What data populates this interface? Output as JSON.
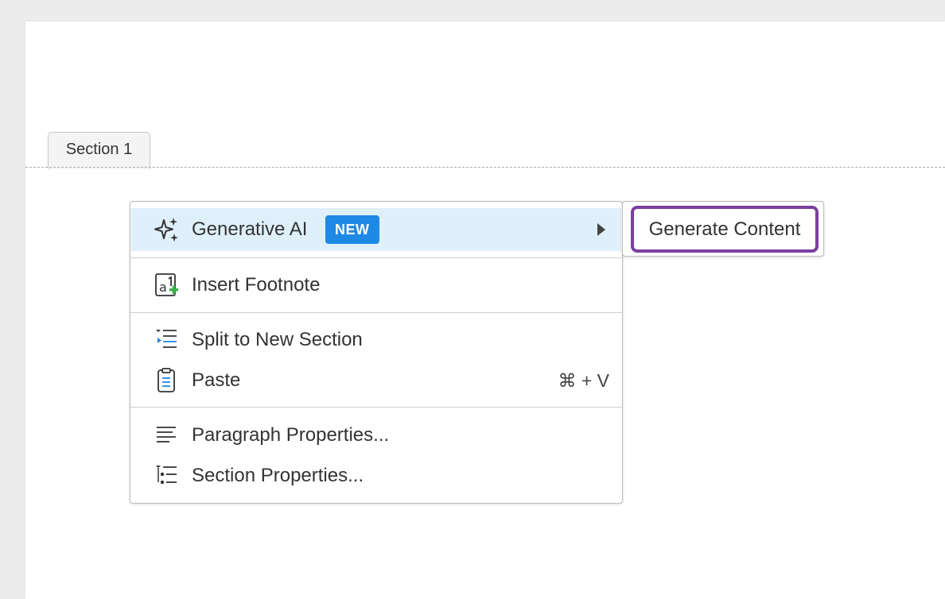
{
  "section": {
    "tab_label": "Section 1"
  },
  "context_menu": {
    "items": [
      {
        "label": "Generative AI",
        "badge": "NEW",
        "icon": "sparkles-icon"
      },
      {
        "label": "Insert Footnote",
        "icon": "footnote-icon"
      },
      {
        "label": "Split to New Section",
        "icon": "split-section-icon"
      },
      {
        "label": "Paste",
        "shortcut": "⌘ + V",
        "icon": "clipboard-icon"
      },
      {
        "label": "Paragraph Properties...",
        "icon": "paragraph-icon"
      },
      {
        "label": "Section Properties...",
        "icon": "section-properties-icon"
      }
    ]
  },
  "submenu": {
    "items": [
      {
        "label": "Generate Content"
      }
    ]
  },
  "colors": {
    "highlight": "#dff0fb",
    "badge": "#1e88e5",
    "focus_ring": "#7b3fa0"
  }
}
